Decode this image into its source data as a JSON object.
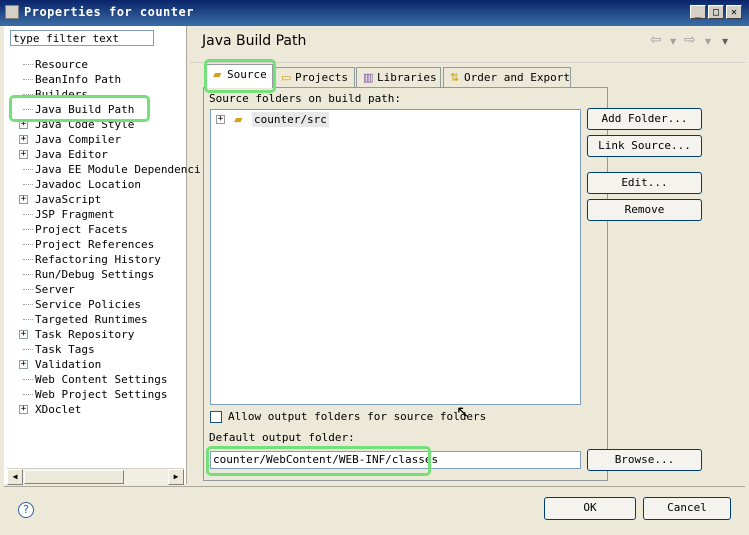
{
  "window": {
    "title": "Properties for counter",
    "controls": [
      "_",
      "□",
      "✕"
    ]
  },
  "filter": {
    "value": "type filter text"
  },
  "tree": {
    "items": [
      {
        "label": "Resource",
        "expandable": false
      },
      {
        "label": "BeanInfo Path",
        "expandable": false
      },
      {
        "label": "Builders",
        "expandable": false
      },
      {
        "label": "Java Build Path",
        "expandable": false,
        "selected": true
      },
      {
        "label": "Java Code Style",
        "expandable": true
      },
      {
        "label": "Java Compiler",
        "expandable": true
      },
      {
        "label": "Java Editor",
        "expandable": true
      },
      {
        "label": "Java EE Module Dependenci",
        "expandable": false
      },
      {
        "label": "Javadoc Location",
        "expandable": false
      },
      {
        "label": "JavaScript",
        "expandable": true
      },
      {
        "label": "JSP Fragment",
        "expandable": false
      },
      {
        "label": "Project Facets",
        "expandable": false
      },
      {
        "label": "Project References",
        "expandable": false
      },
      {
        "label": "Refactoring History",
        "expandable": false
      },
      {
        "label": "Run/Debug Settings",
        "expandable": false
      },
      {
        "label": "Server",
        "expandable": false
      },
      {
        "label": "Service Policies",
        "expandable": false
      },
      {
        "label": "Targeted Runtimes",
        "expandable": false
      },
      {
        "label": "Task Repository",
        "expandable": true
      },
      {
        "label": "Task Tags",
        "expandable": false
      },
      {
        "label": "Validation",
        "expandable": true
      },
      {
        "label": "Web Content Settings",
        "expandable": false
      },
      {
        "label": "Web Project Settings",
        "expandable": false
      },
      {
        "label": "XDoclet",
        "expandable": true
      }
    ]
  },
  "page": {
    "title": "Java Build Path"
  },
  "tabs": [
    {
      "label": "Source",
      "icon": "source-folder-icon",
      "active": true
    },
    {
      "label": "Projects",
      "icon": "projects-icon",
      "active": false
    },
    {
      "label": "Libraries",
      "icon": "libraries-icon",
      "active": false
    },
    {
      "label": "Order and Export",
      "icon": "order-export-icon",
      "active": false
    }
  ],
  "source": {
    "label": "Source folders on build path:",
    "folders": [
      "counter/src"
    ]
  },
  "buttons": {
    "add_folder": "Add Folder...",
    "link_source": "Link Source...",
    "edit": "Edit...",
    "remove": "Remove",
    "browse": "Browse...",
    "ok": "OK",
    "cancel": "Cancel"
  },
  "output": {
    "allow_label": "Allow output folders for source folders",
    "allow_checked": false,
    "default_label": "Default output folder:",
    "default_value": "counter/WebContent/WEB-INF/classes"
  },
  "colors": {
    "highlight": "#74e07a",
    "titlebar": "#0a246a"
  }
}
